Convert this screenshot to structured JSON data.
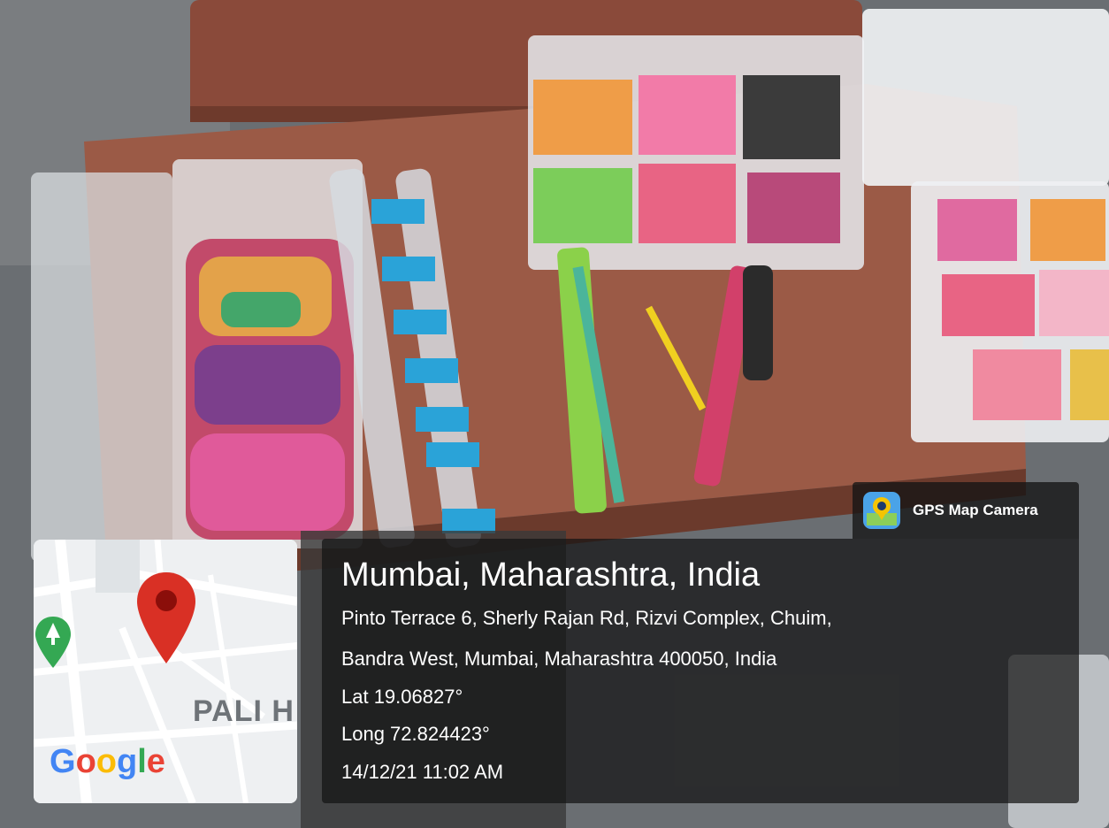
{
  "badge": {
    "label": "GPS Map Camera",
    "icon": "gps-camera-icon"
  },
  "location": {
    "title": "Mumbai, Maharashtra, India",
    "address_line1": "Pinto Terrace 6, Sherly Rajan Rd, Rizvi Complex, Chuim,",
    "address_line2": "Bandra West, Mumbai, Maharashtra 400050, India",
    "lat": "Lat 19.06827°",
    "long": "Long 72.824423°",
    "datetime": "14/12/21 11:02 AM"
  },
  "map": {
    "area_label": "PALI H",
    "logo": "Google",
    "pin_color": "#d93025",
    "park_pin_color": "#34a853"
  }
}
